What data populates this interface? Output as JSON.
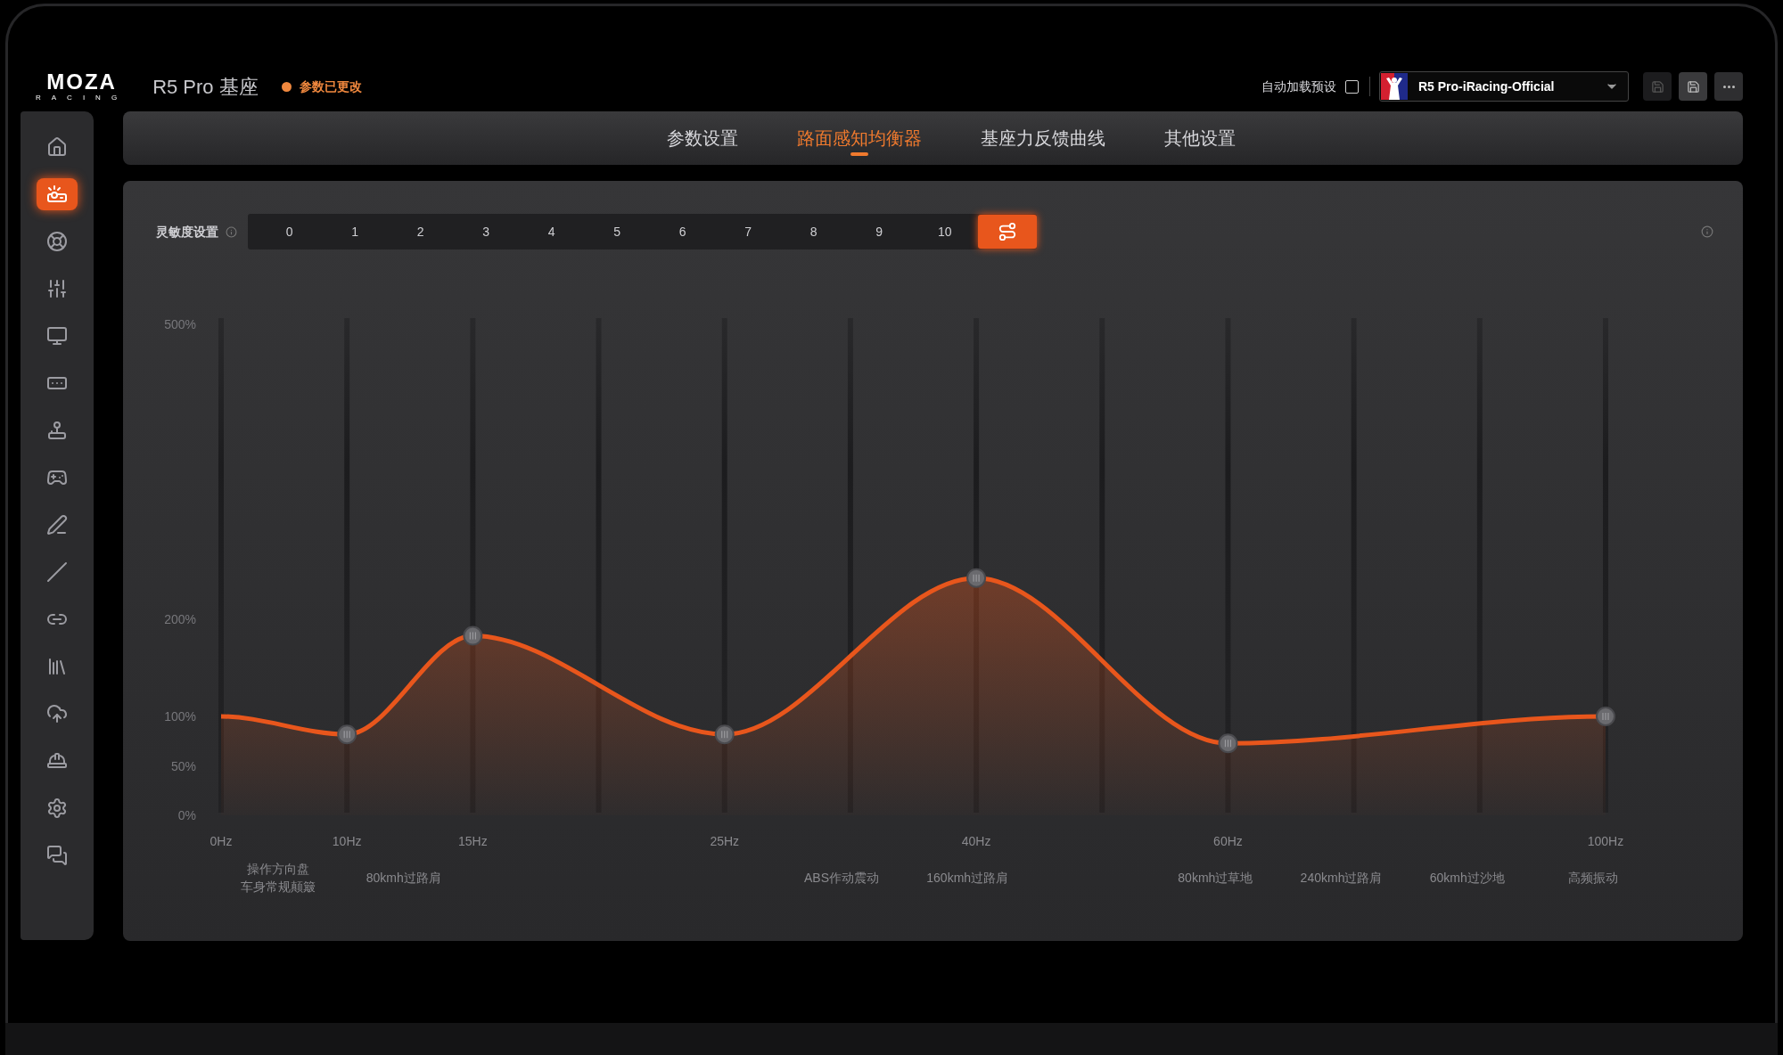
{
  "header": {
    "logo": "MOZA",
    "logo_sub": "RACING",
    "device": "R5 Pro 基座",
    "status": "参数已更改",
    "auto_load": {
      "label": "自动加载预设",
      "checked": false
    },
    "preset": "R5 Pro-iRacing-Official"
  },
  "sidebar": {
    "items": [
      {
        "selected": false
      },
      {
        "selected": true
      },
      {
        "selected": false
      },
      {
        "selected": false
      },
      {
        "selected": false
      },
      {
        "selected": false
      },
      {
        "selected": false
      },
      {
        "selected": false
      },
      {
        "selected": false
      },
      {
        "selected": false
      },
      {
        "selected": false
      },
      {
        "selected": false
      },
      {
        "selected": false
      },
      {
        "selected": false
      },
      {
        "selected": false
      },
      {
        "selected": false
      }
    ]
  },
  "tabs": [
    {
      "label": "参数设置",
      "selected": false
    },
    {
      "label": "路面感知均衡器",
      "selected": true
    },
    {
      "label": "基座力反馈曲线",
      "selected": false
    },
    {
      "label": "其他设置",
      "selected": false
    }
  ],
  "sensitivity": {
    "label": "灵敏度设置",
    "options": [
      {
        "label": "0",
        "selected": false
      },
      {
        "label": "1",
        "selected": false
      },
      {
        "label": "2",
        "selected": false
      },
      {
        "label": "3",
        "selected": false
      },
      {
        "label": "4",
        "selected": false
      },
      {
        "label": "5",
        "selected": false
      },
      {
        "label": "6",
        "selected": false
      },
      {
        "label": "7",
        "selected": false
      },
      {
        "label": "8",
        "selected": false
      },
      {
        "label": "9",
        "selected": false
      },
      {
        "label": "10",
        "selected": false
      }
    ],
    "custom_selected": true
  },
  "chart_data": {
    "type": "area",
    "categories": [
      "0Hz",
      "10Hz",
      "15Hz",
      null,
      "25Hz",
      null,
      "40Hz",
      null,
      "60Hz",
      null,
      null,
      "100Hz"
    ],
    "series": [
      {
        "color": "#e8561c",
        "values": [
          100,
          82,
          183,
          null,
          82,
          null,
          242,
          null,
          73,
          null,
          null,
          100
        ]
      }
    ],
    "ylim": [
      0,
      500
    ],
    "grid": true,
    "yticks": [
      {
        "value": 0,
        "label": "0%"
      },
      {
        "value": 50,
        "label": "50%"
      },
      {
        "value": 100,
        "label": "100%"
      },
      {
        "value": 200,
        "label": "200%"
      },
      {
        "value": 500,
        "label": "500%"
      }
    ],
    "annotations": [
      "操作方向盘",
      "车身常规颠簸",
      "80kmh过路肩",
      "ABS作动震动",
      "160kmh过路肩",
      "80kmh过草地",
      "240kmh过路肩",
      "60kmh过沙地",
      "高频振动"
    ]
  }
}
